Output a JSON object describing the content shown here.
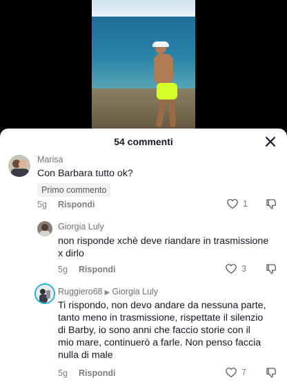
{
  "sheet": {
    "title": "54 commenti"
  },
  "comments": [
    {
      "author": "Marisa",
      "text": "Con Barbara tutto ok?",
      "badge": "Primo commento",
      "time": "5g",
      "reply_label": "Rispondi",
      "likes": "1"
    },
    {
      "author": "Giorgia Luly",
      "text_lines": [
        "non risponde xchè deve riandare in trasmissione",
        "x dirlo"
      ],
      "time": "5g",
      "reply_label": "Rispondi",
      "likes": "3"
    },
    {
      "author": "Ruggiero68",
      "reply_to": "Giorgia Luly",
      "text_lines": [
        "Ti rispondo, non devo andare da nessuna parte,",
        "tanto meno in trasmissione, rispettate il silenzio",
        "di Barby, io sono anni che faccio storie con il",
        "mio mare, continuerò a farle. Non penso faccia",
        "nulla di male"
      ],
      "time": "5g",
      "reply_label": "Rispondi",
      "likes": "7"
    }
  ],
  "colors": {
    "text": "#161823",
    "secondary": "#7d7e84",
    "highlight_ring": "#1fb6c9",
    "badge_bg": "#f1f1f2"
  },
  "icons": [
    "close-icon",
    "heart-icon",
    "dislike-icon"
  ]
}
